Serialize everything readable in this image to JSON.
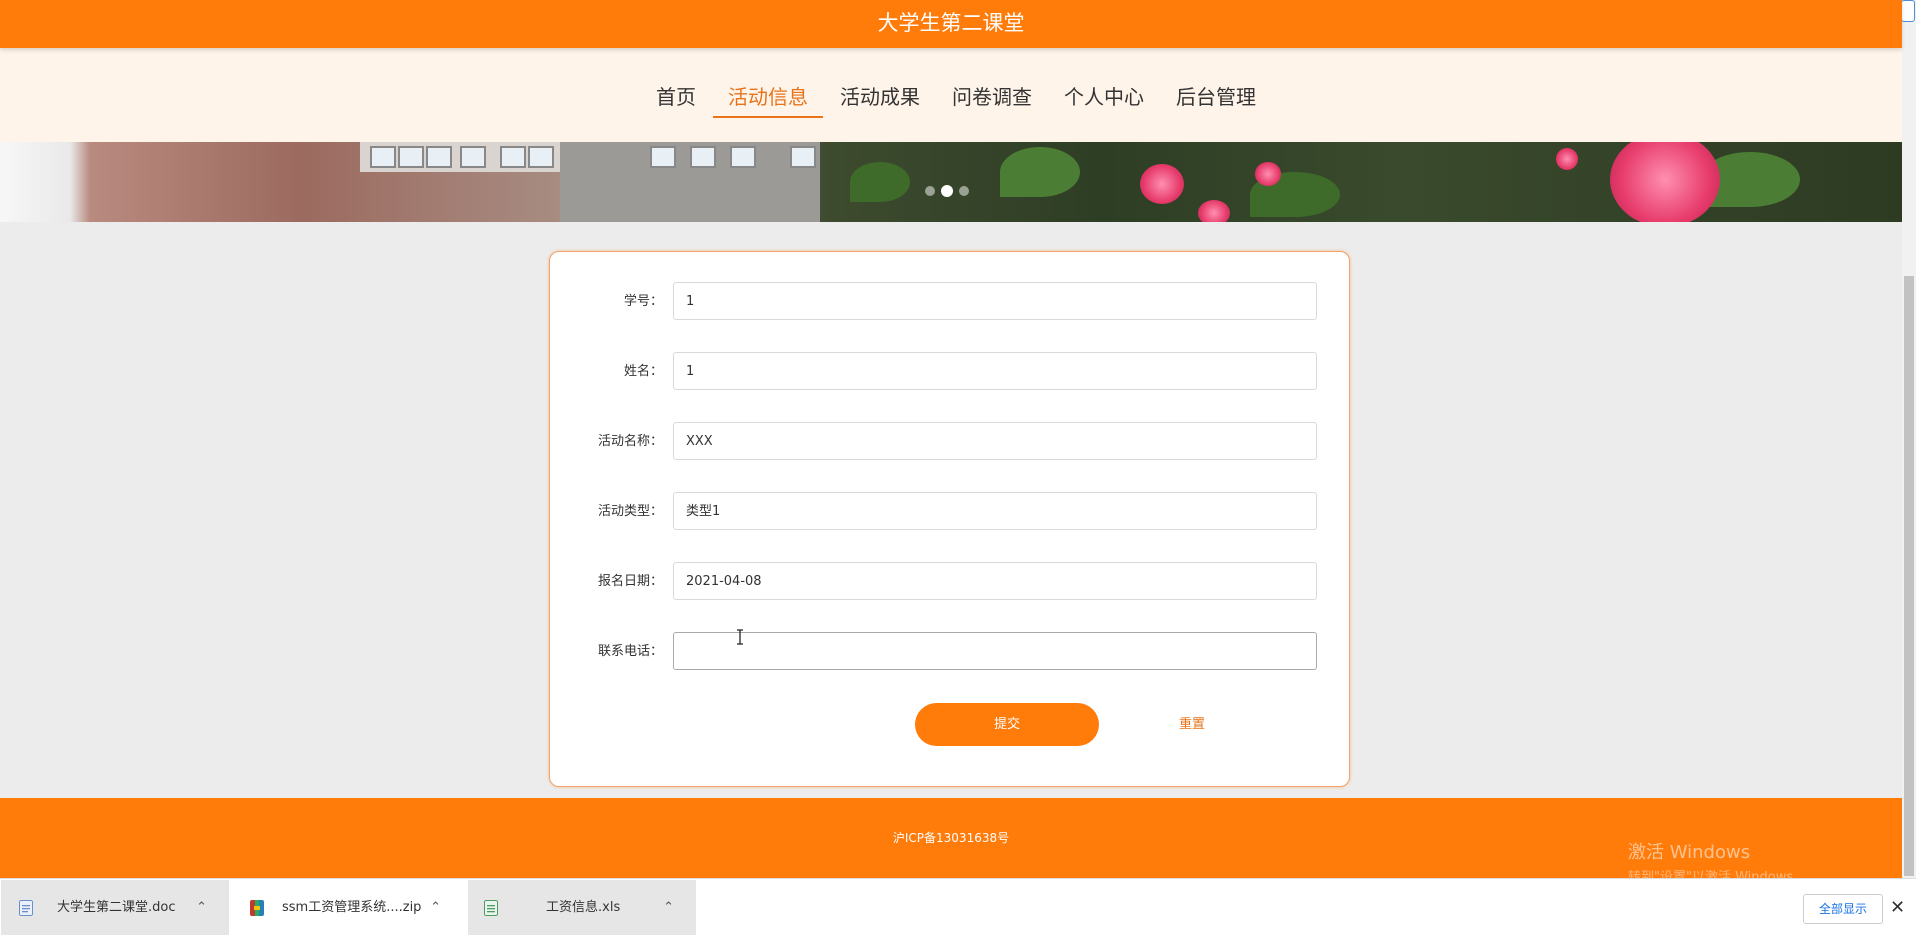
{
  "site": {
    "title": "大学生第二课堂"
  },
  "nav": {
    "items": [
      {
        "label": "首页"
      },
      {
        "label": "活动信息"
      },
      {
        "label": "活动成果"
      },
      {
        "label": "问卷调查"
      },
      {
        "label": "个人中心"
      },
      {
        "label": "后台管理"
      }
    ],
    "active_index": 1
  },
  "form": {
    "fields": [
      {
        "label": "学号：",
        "value": "1"
      },
      {
        "label": "姓名：",
        "value": "1"
      },
      {
        "label": "活动名称：",
        "value": "XXX"
      },
      {
        "label": "活动类型：",
        "value": "类型1"
      },
      {
        "label": "报名日期：",
        "value": "2021-04-08"
      },
      {
        "label": "联系电话：",
        "value": ""
      }
    ],
    "submit_label": "提交",
    "reset_label": "重置"
  },
  "footer": {
    "icp": "沪ICP备13031638号",
    "watermark_title": "激活 Windows",
    "watermark_sub": "转到\"设置\"以激活 Windows。"
  },
  "downloads": {
    "items": [
      {
        "name": "大学生第二课堂.doc",
        "icon": "word-doc-icon"
      },
      {
        "name": "ssm工资管理系统....zip",
        "icon": "zip-archive-icon"
      },
      {
        "name": "工资信息.xls",
        "icon": "excel-sheet-icon"
      }
    ],
    "show_all_label": "全部显示"
  },
  "colors": {
    "primary": "#ff7b0a",
    "nav_bg": "#fff4ea",
    "active_nav": "#e8731a",
    "page_bg": "#ececec"
  }
}
